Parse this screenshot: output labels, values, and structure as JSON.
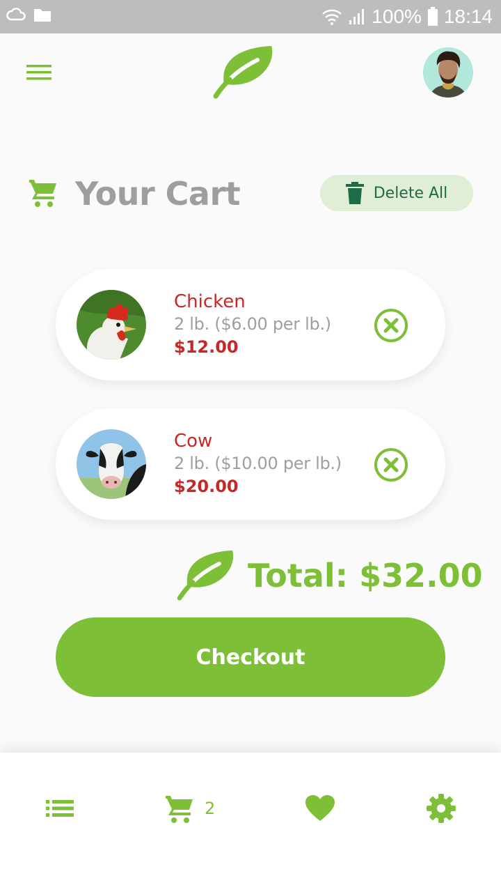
{
  "colors": {
    "accent": "#7dbf37",
    "price_red": "#c62828",
    "muted_gray": "#9e9e9e",
    "delete_bg": "#e1eed6",
    "delete_fg": "#1e6b48"
  },
  "status_bar": {
    "battery": "100%",
    "time": "18:14",
    "icons": [
      "cloud-icon",
      "folder-icon",
      "wifi-icon",
      "signal-icon",
      "battery-icon"
    ]
  },
  "header": {
    "menu_icon": "hamburger-menu-icon",
    "logo_icon": "leaf-logo-icon",
    "avatar": "user-avatar"
  },
  "cart": {
    "title": "Your Cart",
    "delete_all_label": "Delete All",
    "items": [
      {
        "name": "Chicken",
        "quantity": "2 lb. ($6.00 per lb.)",
        "price": "$12.00",
        "image": "chicken-photo"
      },
      {
        "name": "Cow",
        "quantity": "2 lb. ($10.00 per lb.)",
        "price": "$20.00",
        "image": "cow-photo"
      }
    ],
    "total_label": "Total: $32.00",
    "checkout_label": "Checkout"
  },
  "bottom_nav": {
    "items": [
      {
        "icon": "list-icon"
      },
      {
        "icon": "cart-icon",
        "badge": "2"
      },
      {
        "icon": "heart-icon"
      },
      {
        "icon": "gear-icon"
      }
    ]
  }
}
